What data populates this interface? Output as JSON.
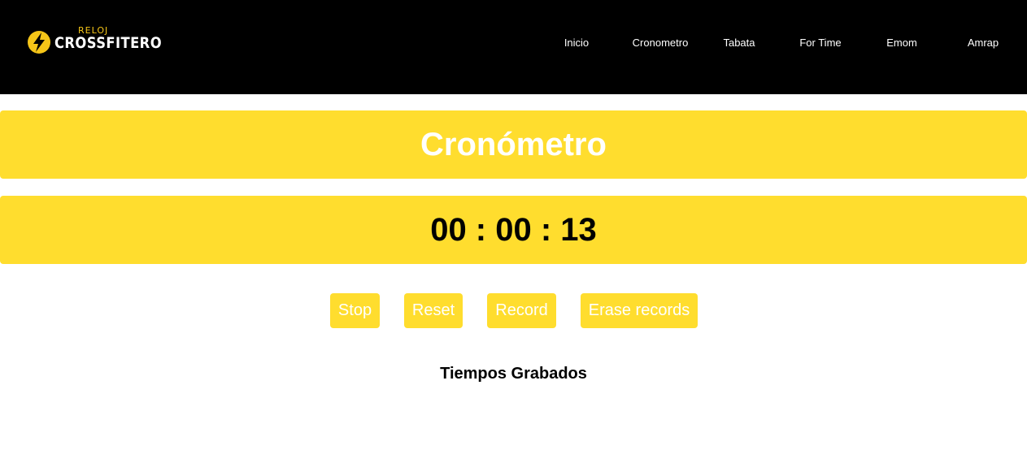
{
  "brand": {
    "small": "RELOJ",
    "big": "CROSSFITERO",
    "icon": "lightning-bolt-icon",
    "accent": "#f5c518"
  },
  "nav": {
    "items": [
      "Inicio",
      "Cronometro",
      "Tabata",
      "For Time",
      "Emom",
      "Amrap"
    ]
  },
  "main": {
    "title": "Cronómetro",
    "time": "00 : 00 : 13"
  },
  "controls": {
    "stop": "Stop",
    "reset": "Reset",
    "record": "Record",
    "erase": "Erase records"
  },
  "records": {
    "title": "Tiempos Grabados",
    "items": []
  },
  "colors": {
    "header_bg": "#000000",
    "panel_bg": "#ffdd2e",
    "panel_text": "#ffffff",
    "clock_text": "#000000"
  }
}
